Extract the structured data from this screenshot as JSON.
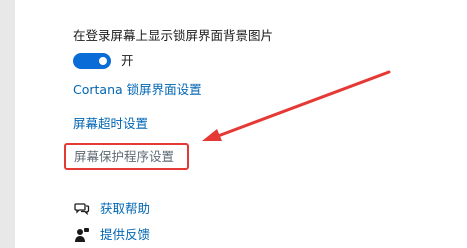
{
  "lockscreen": {
    "show_background_on_signin_label": "在登录屏幕上显示锁屏界面背景图片",
    "toggle_state_label": "开",
    "toggle_on": true
  },
  "links": {
    "cortana": "Cortana 锁屏界面设置",
    "screen_timeout": "屏幕超时设置",
    "screen_saver": "屏幕保护程序设置"
  },
  "help": {
    "get_help": "获取帮助",
    "give_feedback": "提供反馈"
  },
  "icons": {
    "get_help": "help-chat-icon",
    "give_feedback": "feedback-person-icon"
  },
  "colors": {
    "accent": "#0a6cd6",
    "link": "#0066b4",
    "highlight": "#e53935"
  }
}
